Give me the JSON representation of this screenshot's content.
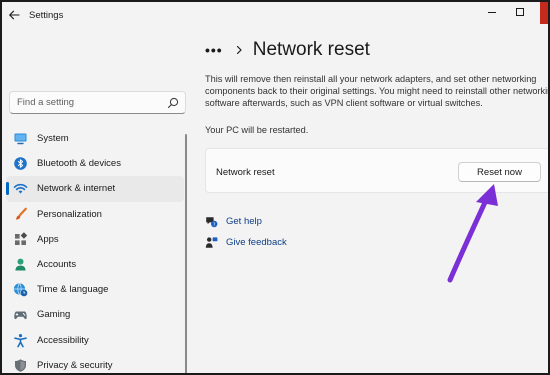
{
  "window": {
    "title": "Settings"
  },
  "search": {
    "placeholder": "Find a setting"
  },
  "sidebar": {
    "items": [
      {
        "label": "System",
        "icon": "monitor-icon"
      },
      {
        "label": "Bluetooth & devices",
        "icon": "bluetooth-icon"
      },
      {
        "label": "Network & internet",
        "icon": "wifi-icon",
        "selected": true
      },
      {
        "label": "Personalization",
        "icon": "brush-icon"
      },
      {
        "label": "Apps",
        "icon": "apps-icon"
      },
      {
        "label": "Accounts",
        "icon": "accounts-icon"
      },
      {
        "label": "Time & language",
        "icon": "globe-clock-icon"
      },
      {
        "label": "Gaming",
        "icon": "gamepad-icon"
      },
      {
        "label": "Accessibility",
        "icon": "accessibility-icon"
      },
      {
        "label": "Privacy & security",
        "icon": "shield-icon"
      }
    ]
  },
  "main": {
    "breadcrumb_more": "•••",
    "page_title": "Network reset",
    "description_lines": [
      "This will remove then reinstall all your network adapters, and set other networking",
      "components back to their original settings. You might need to reinstall other networking",
      "software afterwards, such as VPN client software or virtual switches."
    ],
    "restart_note": "Your PC will be restarted.",
    "reset_card": {
      "label": "Network reset",
      "button_label": "Reset now"
    },
    "links": {
      "get_help": "Get help",
      "give_feedback": "Give feedback"
    }
  },
  "colors": {
    "accent": "#0067c0",
    "annotation_arrow": "#7b2fd6",
    "close_button": "#c42b1c"
  }
}
